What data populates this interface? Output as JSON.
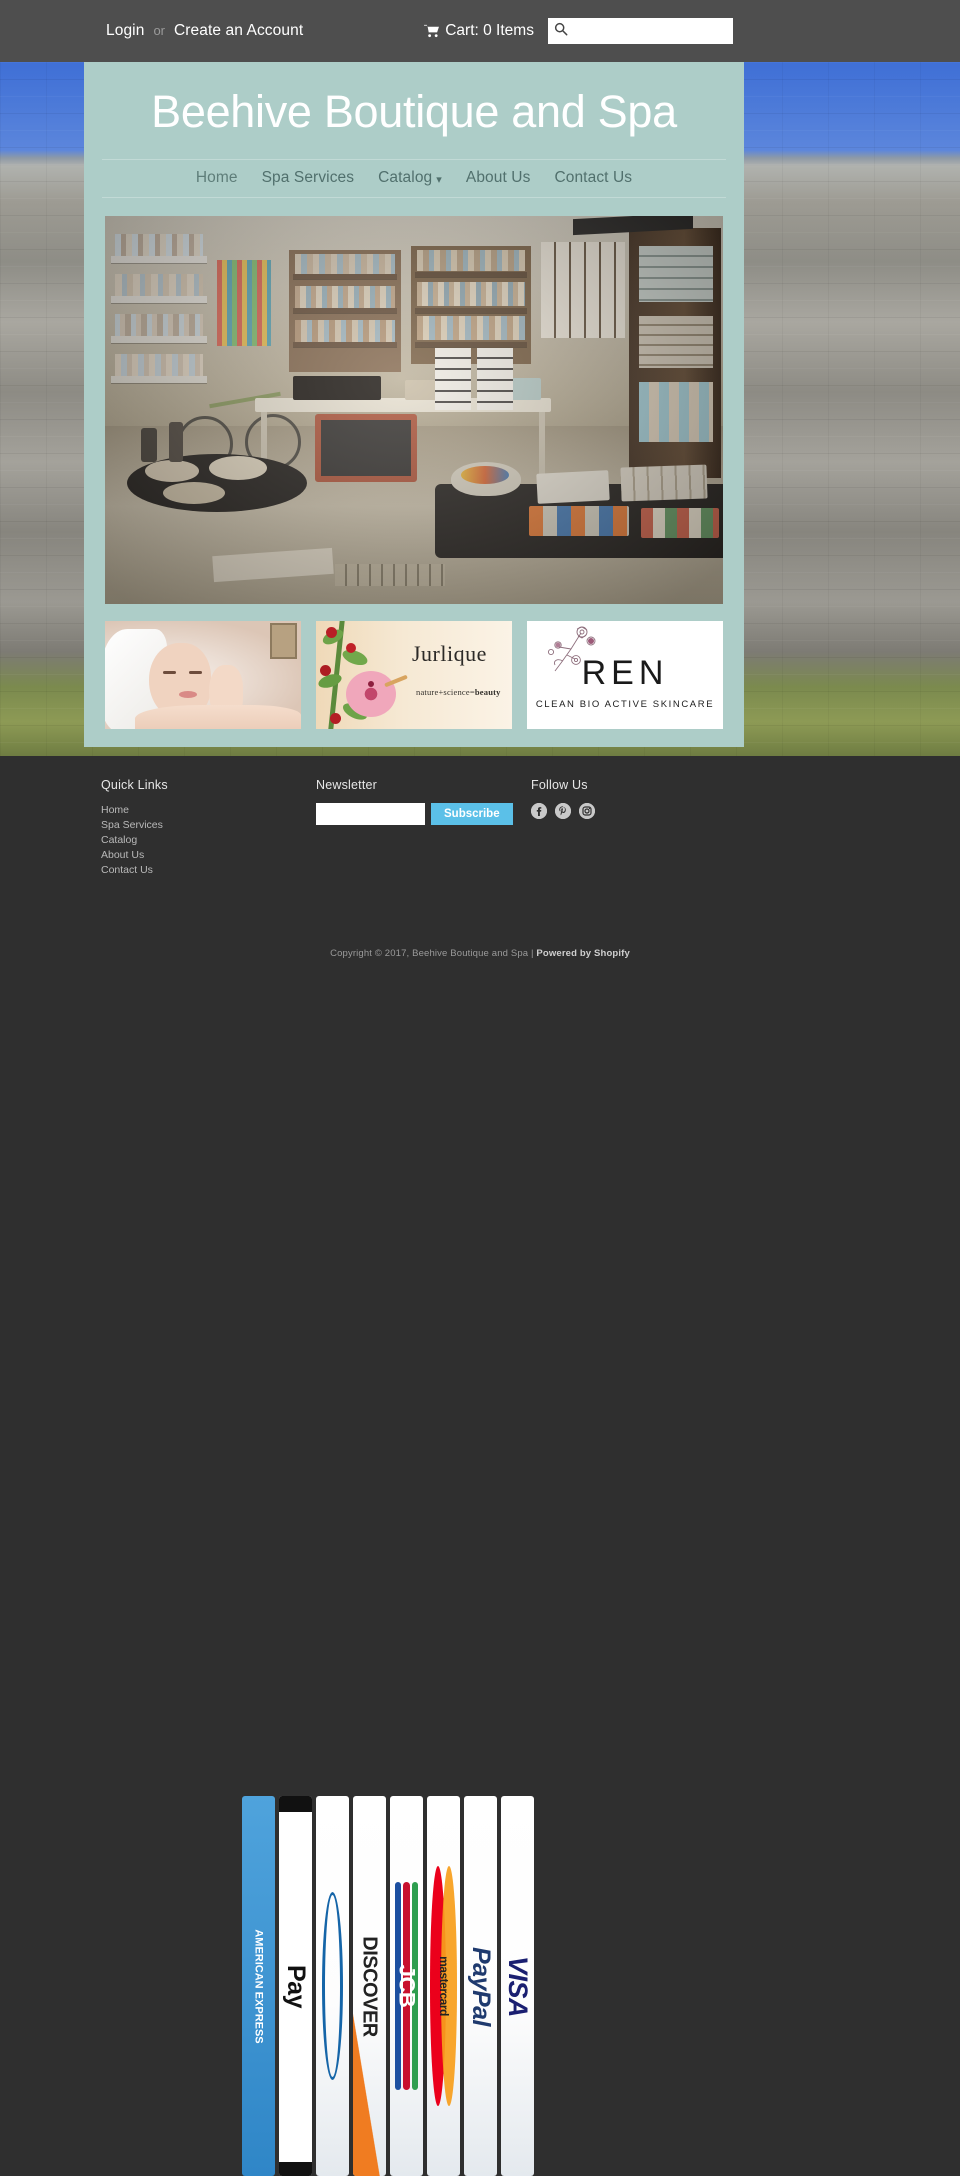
{
  "topbar": {
    "login_label": "Login",
    "separator": "or",
    "create_account_label": "Create an Account",
    "cart_label": "Cart: 0 Items",
    "cart_icon": "shopping-cart-icon",
    "search_icon": "search-icon",
    "search_value": "",
    "search_placeholder": "",
    "background_color": "#4e4e4e"
  },
  "header": {
    "site_title": "Beehive Boutique and Spa",
    "background_color": "#adcdc8",
    "title_color": "#ffffff"
  },
  "nav": {
    "items": [
      {
        "label": "Home",
        "active": true,
        "has_dropdown": false
      },
      {
        "label": "Spa Services",
        "active": false,
        "has_dropdown": false
      },
      {
        "label": "Catalog",
        "active": false,
        "has_dropdown": true,
        "caret": "chevron-down-icon"
      },
      {
        "label": "About Us",
        "active": false,
        "has_dropdown": false
      },
      {
        "label": "Contact Us",
        "active": false,
        "has_dropdown": false
      }
    ]
  },
  "hero": {
    "alt": "Interior photo of the Beehive Boutique retail shop with shelves of products, display tables, bicycle and chalkboard sign"
  },
  "promos": [
    {
      "name": "spa-facial-promo",
      "alt": "Woman receiving a facial spa treatment",
      "caption": ""
    },
    {
      "name": "jurlique-promo",
      "brand": "Jurlique",
      "tagline_plain": "nature+science=",
      "tagline_bold": "beauty"
    },
    {
      "name": "ren-promo",
      "brand": "REN",
      "tagline": "CLEAN BIO ACTIVE SKINCARE"
    }
  ],
  "footer": {
    "quick_links_title": "Quick Links",
    "quick_links": [
      "Home",
      "Spa Services",
      "Catalog",
      "About Us",
      "Contact Us"
    ],
    "newsletter_title": "Newsletter",
    "newsletter_value": "",
    "newsletter_placeholder": "",
    "subscribe_label": "Subscribe",
    "subscribe_color": "#5bc0e8",
    "follow_title": "Follow Us",
    "social": [
      {
        "name": "facebook-icon",
        "label": "Facebook"
      },
      {
        "name": "pinterest-icon",
        "label": "Pinterest"
      },
      {
        "name": "instagram-icon",
        "label": "Instagram"
      }
    ],
    "copyright_text": "Copyright © 2017, Beehive Boutique and Spa | ",
    "powered_by": "Powered by Shopify",
    "background_color": "#2f2f2f"
  },
  "payments": [
    {
      "name": "american-express",
      "label": "AMERICAN EXPRESS"
    },
    {
      "name": "apple-pay",
      "label": "Pay"
    },
    {
      "name": "diners-club",
      "label": ""
    },
    {
      "name": "discover",
      "label": "DISCOVER"
    },
    {
      "name": "jcb",
      "label": "JCB"
    },
    {
      "name": "mastercard",
      "label": "mastercard"
    },
    {
      "name": "paypal",
      "label": "PayPal"
    },
    {
      "name": "visa",
      "label": "VISA"
    }
  ]
}
